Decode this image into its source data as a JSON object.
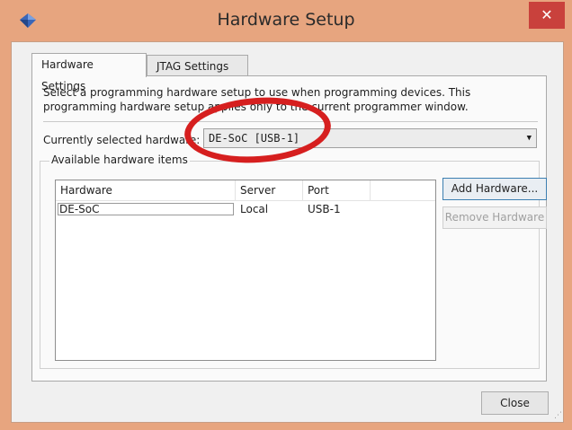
{
  "window": {
    "title": "Hardware Setup",
    "close_glyph": "✕",
    "icon": "diamond-app-icon"
  },
  "tabs": [
    {
      "label": "Hardware Settings",
      "active": true
    },
    {
      "label": "JTAG Settings",
      "active": false
    }
  ],
  "panel": {
    "description": "Select a programming hardware setup to use when programming devices. This programming hardware setup applies only to the current programmer window.",
    "selected_label": "Currently selected hardware:",
    "selected_value": "DE-SoC [USB-1]",
    "group_label": "Available hardware items"
  },
  "table": {
    "columns": [
      "Hardware",
      "Server",
      "Port"
    ],
    "rows": [
      {
        "hardware": "DE-SoC",
        "server": "Local",
        "port": "USB-1"
      }
    ]
  },
  "buttons": {
    "add": "Add Hardware...",
    "remove": "Remove Hardware",
    "close": "Close"
  },
  "colors": {
    "title_bar": "#e7a57f",
    "close_button": "#c9413c",
    "annotation_circle": "#d61f1f"
  }
}
